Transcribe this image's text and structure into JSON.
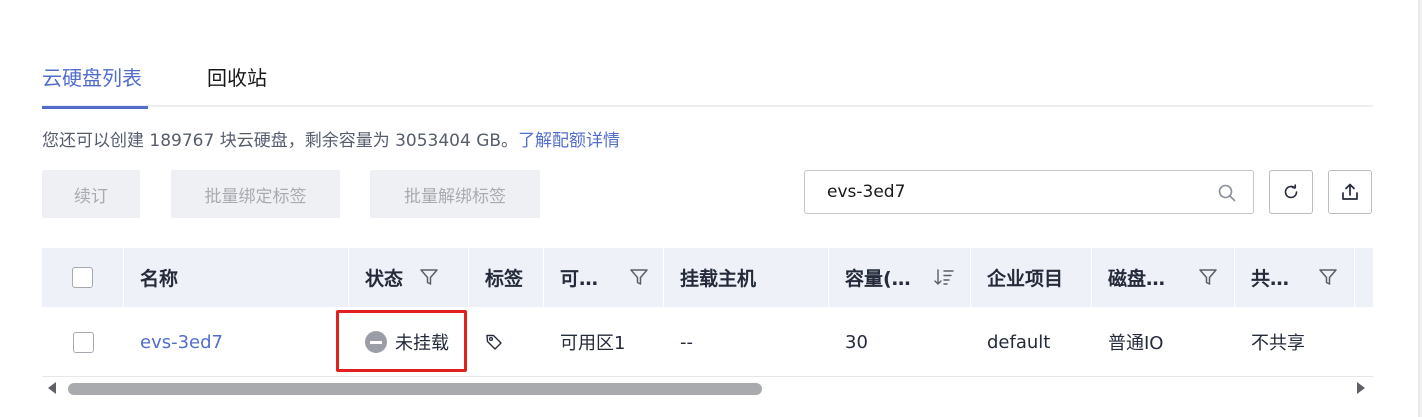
{
  "tabs": [
    {
      "label": "云硬盘列表",
      "active": true
    },
    {
      "label": "回收站",
      "active": false
    }
  ],
  "info": {
    "text": "您还可以创建 189767 块云硬盘，剩余容量为 3053404 GB。",
    "link": "了解配额详情"
  },
  "toolbar": {
    "renew_label": "续订",
    "bind_tags_label": "批量绑定标签",
    "unbind_tags_label": "批量解绑标签",
    "search_value": "evs-3ed7"
  },
  "table": {
    "columns": [
      "名称",
      "状态",
      "标签",
      "可…",
      "挂载主机",
      "容量(…",
      "企业项目",
      "磁盘…",
      "共…"
    ],
    "rows": [
      {
        "name": "evs-3ed7",
        "status": "未挂载",
        "az": "可用区1",
        "host": "--",
        "capacity": "30",
        "project": "default",
        "disk_type": "普通IO",
        "share": "不共享"
      }
    ]
  },
  "colors": {
    "accent": "#526ecc",
    "highlight": "#e02020",
    "header_bg": "#eef1f7",
    "status_gray": "#9b9ea6"
  }
}
